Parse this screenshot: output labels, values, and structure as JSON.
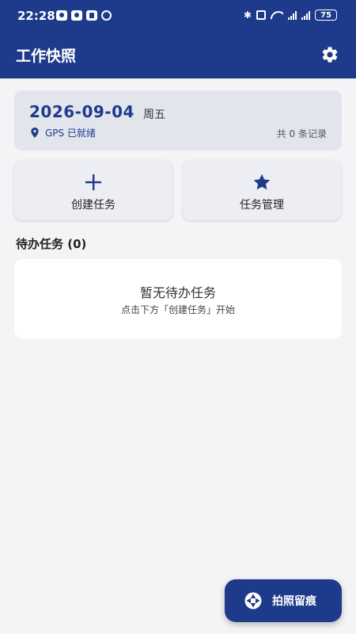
{
  "status_bar": {
    "time": "22:28",
    "battery": "75",
    "bluetooth_glyph": "✱"
  },
  "app_bar": {
    "title": "工作快照",
    "settings_icon": "gear-icon"
  },
  "date_card": {
    "date": "2026-09-04",
    "weekday": "周五",
    "gps_status": "GPS 已就绪",
    "record_count": "共 0 条记录"
  },
  "actions": {
    "create_label": "创建任务",
    "manage_label": "任务管理"
  },
  "pending": {
    "title": "待办任务 (0)",
    "empty_title": "暂无待办任务",
    "empty_hint": "点击下方「创建任务」开始"
  },
  "fab": {
    "label": "拍照留痕",
    "icon": "camera-shutter-icon"
  },
  "colors": {
    "primary": "#1e3a8a",
    "background": "#f4f4f6",
    "card": "#e3e5ec"
  }
}
